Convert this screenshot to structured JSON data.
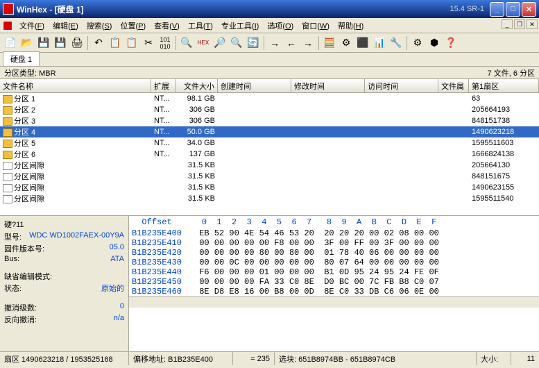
{
  "titlebar": {
    "app": "WinHex",
    "doc": "[硬盘 1]",
    "version": "15.4 SR-1"
  },
  "menu": {
    "file": "文件",
    "file_k": "F",
    "edit": "编辑",
    "edit_k": "E",
    "search": "搜索",
    "search_k": "S",
    "position": "位置",
    "position_k": "P",
    "view": "查看",
    "view_k": "V",
    "tools": "工具",
    "tools_k": "T",
    "pro": "专业工具",
    "pro_k": "I",
    "options": "选项",
    "options_k": "O",
    "window": "窗口",
    "window_k": "W",
    "help": "帮助",
    "help_k": "H"
  },
  "tab": {
    "label": "硬盘 1"
  },
  "info": {
    "left": "分区类型: MBR",
    "right": "7 文件, 6 分区"
  },
  "cols": {
    "name": "文件名称",
    "ext": "扩展",
    "size": "文件大小",
    "ctime": "创建时间",
    "mtime": "修改时间",
    "atime": "访问时间",
    "attr": "文件属",
    "sector": "第1扇区"
  },
  "rows": [
    {
      "name": "分区 1",
      "ext": "NT...",
      "size": "98.1 GB",
      "sector": "63",
      "icon": "part"
    },
    {
      "name": "分区 2",
      "ext": "NT...",
      "size": "306 GB",
      "sector": "205664193",
      "icon": "part"
    },
    {
      "name": "分区 3",
      "ext": "NT...",
      "size": "306 GB",
      "sector": "848151738",
      "icon": "part"
    },
    {
      "name": "分区 4",
      "ext": "NT...",
      "size": "50.0 GB",
      "sector": "1490623218",
      "icon": "part",
      "sel": true
    },
    {
      "name": "分区 5",
      "ext": "NT...",
      "size": "34.0 GB",
      "sector": "1595511603",
      "icon": "part"
    },
    {
      "name": "分区 6",
      "ext": "NT...",
      "size": "137 GB",
      "sector": "1666824138",
      "icon": "part"
    },
    {
      "name": "分区间隙",
      "ext": "",
      "size": "31.5 KB",
      "sector": "205664130",
      "icon": "gap"
    },
    {
      "name": "分区间隙",
      "ext": "",
      "size": "31.5 KB",
      "sector": "848151675",
      "icon": "gap"
    },
    {
      "name": "分区间隙",
      "ext": "",
      "size": "31.5 KB",
      "sector": "1490623155",
      "icon": "gap"
    },
    {
      "name": "分区间隙",
      "ext": "",
      "size": "31.5 KB",
      "sector": "1595511540",
      "icon": "gap"
    }
  ],
  "left": {
    "hard": "硬?11",
    "model_l": "型号:",
    "model_v": "WDC WD1002FAEX-00Y9A",
    "fw_l": "固件版本号:",
    "fw_v": "05.0",
    "bus_l": "Bus:",
    "bus_v": "ATA",
    "mode_l": "缺省编辑模式:",
    "state_l": "状态:",
    "state_v": "原始的",
    "undo_l": "撤消级数:",
    "undo_v": "0",
    "redo_l": "反向撤消:",
    "redo_v": "n/a"
  },
  "hex": {
    "header": "  Offset      0  1  2  3  4  5  6  7   8  9  A  B  C  D  E  F",
    "lines": [
      {
        "off": "B1B235E400",
        "b": "EB 52 90 4E 54 46 53 20  20 20 20 00 02 08 00 00"
      },
      {
        "off": "B1B235E410",
        "b": "00 00 00 00 00 F8 00 00  3F 00 FF 00 3F 00 00 00"
      },
      {
        "off": "B1B235E420",
        "b": "00 00 00 00 80 00 80 00  01 78 40 06 00 00 00 00"
      },
      {
        "off": "B1B235E430",
        "b": "00 00 0C 00 00 00 00 00  80 07 64 00 00 00 00 00"
      },
      {
        "off": "B1B235E440",
        "b": "F6 00 00 00 01 00 00 00  B1 0D 95 24 95 24 FE 0F"
      },
      {
        "off": "B1B235E450",
        "b": "00 00 00 00 FA 33 C0 8E  D0 BC 00 7C FB B8 C0 07"
      },
      {
        "off": "B1B235E460",
        "b": "8E D8 E8 16 00 B8 00 0D  8E C0 33 DB C6 06 0E 00"
      }
    ]
  },
  "status": {
    "sector": "扇区 1490623218 / 1953525168",
    "offset": "偏移地址: B1B235E400",
    "eq": "= 235",
    "sel": "选块: 651B8974BB - 651B8974CB",
    "size": "大小:",
    "sizev": "11"
  }
}
